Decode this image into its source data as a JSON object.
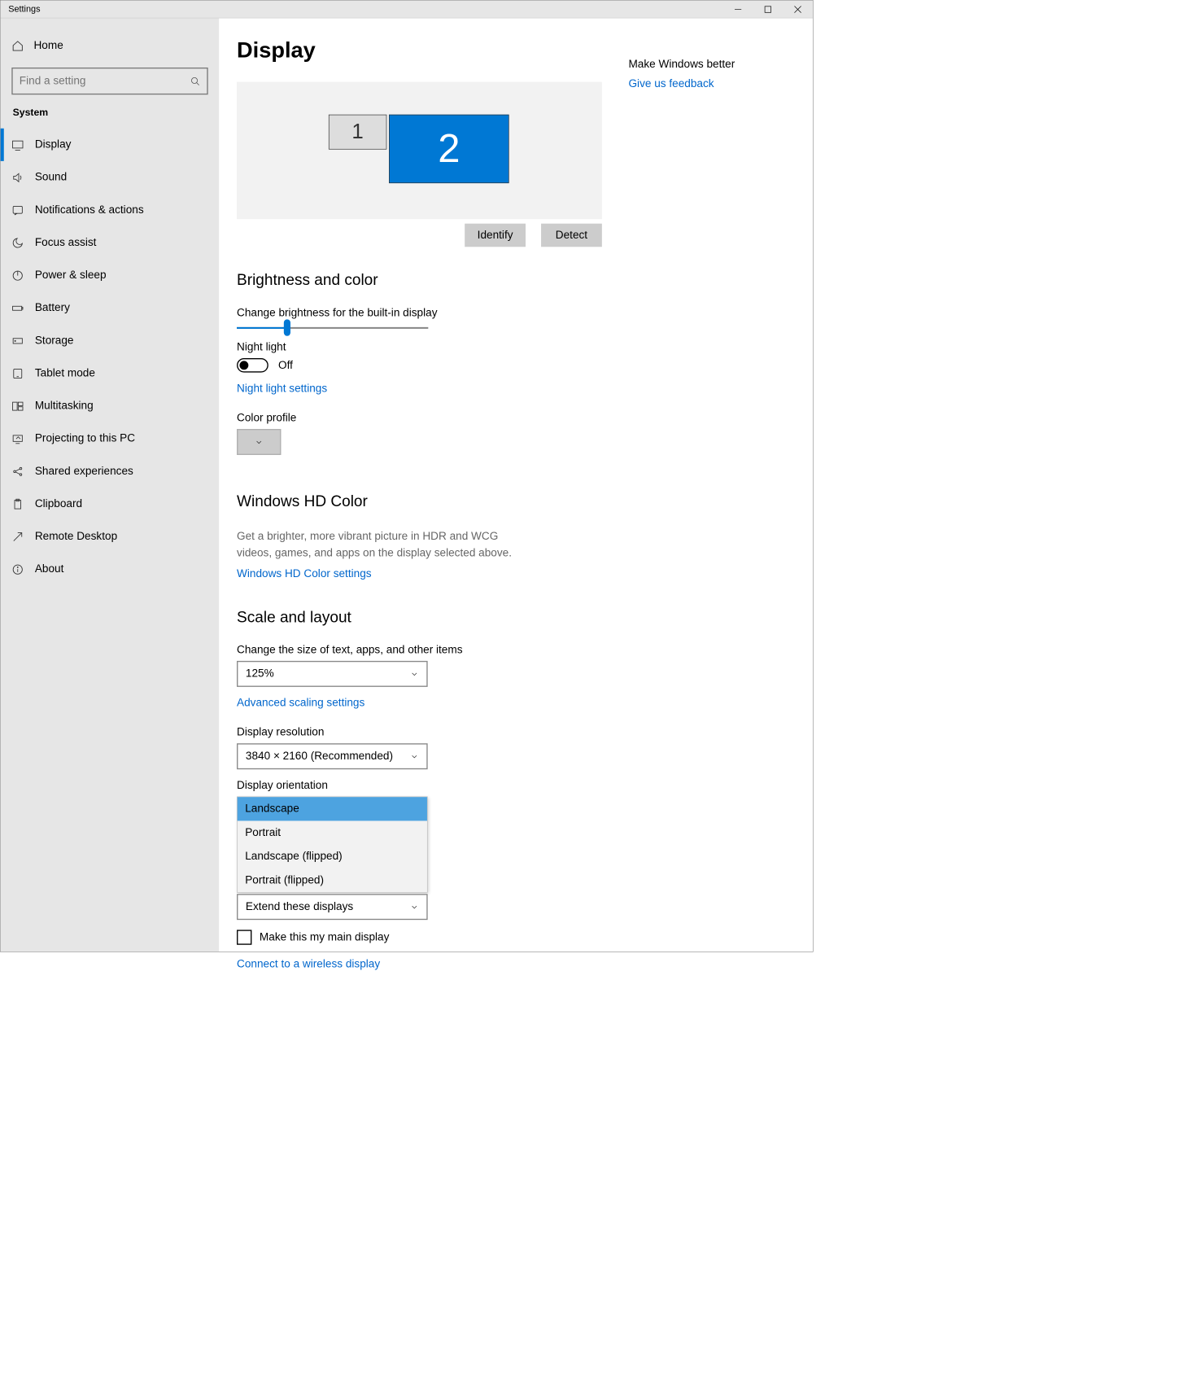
{
  "window": {
    "title": "Settings"
  },
  "sidebar": {
    "home": "Home",
    "search_placeholder": "Find a setting",
    "category": "System",
    "items": [
      {
        "label": "Display",
        "active": true
      },
      {
        "label": "Sound"
      },
      {
        "label": "Notifications & actions"
      },
      {
        "label": "Focus assist"
      },
      {
        "label": "Power & sleep"
      },
      {
        "label": "Battery"
      },
      {
        "label": "Storage"
      },
      {
        "label": "Tablet mode"
      },
      {
        "label": "Multitasking"
      },
      {
        "label": "Projecting to this PC"
      },
      {
        "label": "Shared experiences"
      },
      {
        "label": "Clipboard"
      },
      {
        "label": "Remote Desktop"
      },
      {
        "label": "About"
      }
    ]
  },
  "page": {
    "title": "Display",
    "monitors": {
      "m1": "1",
      "m2": "2"
    },
    "identify_btn": "Identify",
    "detect_btn": "Detect",
    "brightness_section": "Brightness and color",
    "brightness_label": "Change brightness for the built-in display",
    "brightness_percent": 26,
    "night_light_label": "Night light",
    "night_light_state": "Off",
    "night_light_link": "Night light settings",
    "color_profile_label": "Color profile",
    "hd_section": "Windows HD Color",
    "hd_descr": "Get a brighter, more vibrant picture in HDR and WCG videos, games, and apps on the display selected above.",
    "hd_link": "Windows HD Color settings",
    "scale_section": "Scale and layout",
    "scale_label": "Change the size of text, apps, and other items",
    "scale_value": "125%",
    "adv_scaling_link": "Advanced scaling settings",
    "resolution_label": "Display resolution",
    "resolution_value": "3840 × 2160 (Recommended)",
    "orientation_label": "Display orientation",
    "orientation_options": [
      "Landscape",
      "Portrait",
      "Landscape (flipped)",
      "Portrait (flipped)"
    ],
    "multi_value": "Extend these displays",
    "main_display_check": "Make this my main display",
    "wireless_link": "Connect to a wireless display"
  },
  "right": {
    "heading": "Make Windows better",
    "feedback": "Give us feedback"
  }
}
